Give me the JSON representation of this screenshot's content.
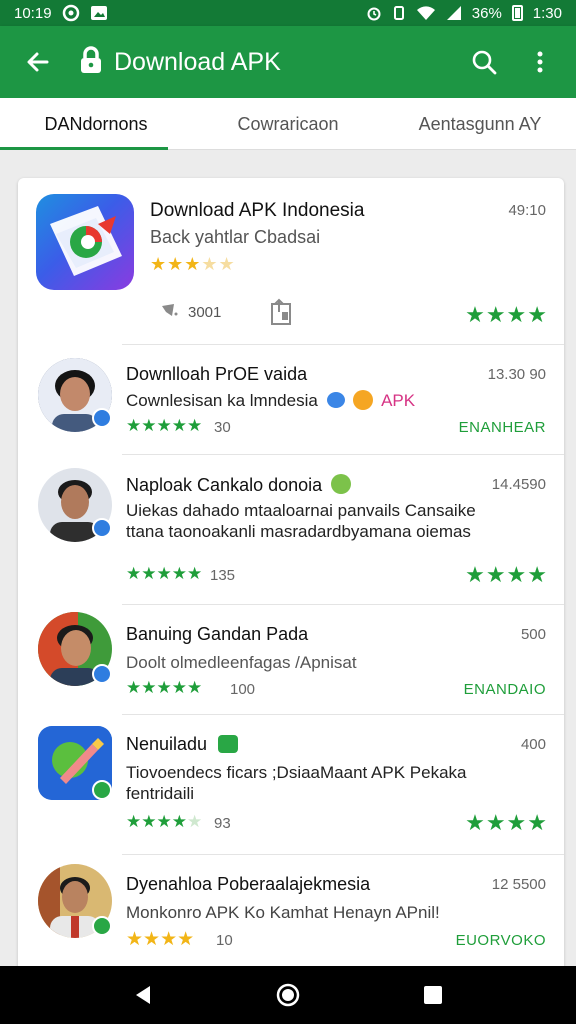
{
  "status_bar": {
    "time": "10:19",
    "battery": "36%",
    "clock_right": "1:30"
  },
  "app_bar": {
    "title": "Download APK"
  },
  "tabs": [
    {
      "label": "DANdornons"
    },
    {
      "label": "Cowraricaon"
    },
    {
      "label": "Aentasgunn AY"
    }
  ],
  "featured": {
    "title": "Download APK Indonesia",
    "subtitle": "Back yahtlar Cbadsai",
    "stars": "★★★☆☆",
    "time": "49:10",
    "count": "3001"
  },
  "rows": [
    {
      "title": "Downlloah PrOE vaida",
      "desc": "Cownlesisan ka lmndesia",
      "desc_tail": "APK",
      "time": "13.30 90",
      "count": "30",
      "action": "ENANHEAR"
    },
    {
      "title": "Naploak Cankalo donoia",
      "desc": "Uiekas dahado mtaaloarnai panvails Cansaike ttana taonoakanli masradardbyamana oiemas",
      "time": "14.4590",
      "count": "135"
    },
    {
      "title": "Banuing Gandan Pada",
      "desc": "Doolt olmedleenfagas /Apnisat",
      "time": "500",
      "count": "100",
      "action": "ENANDAIO"
    },
    {
      "title": "Nenuiladu",
      "desc": "Tiovoendecs ficars ;DsiaaMaant APK Pekaka fentridaili",
      "time": "400",
      "count": "93"
    },
    {
      "title": "Dyenahloa Poberaalajekmesia",
      "desc": "Monkonro APK Ko Kamhat Henayn APnil!",
      "time": "12 5500",
      "count": "10",
      "action": "EUORVOKO"
    }
  ],
  "colors": {
    "primary": "#1d9644",
    "status": "#137a36",
    "star_green": "#1f9e3a",
    "star_gold": "#f2b517"
  },
  "icons": [
    "back-arrow-icon",
    "lock-icon",
    "search-icon",
    "more-vert-icon",
    "pin-icon",
    "share-icon",
    "nav-back-icon",
    "nav-home-icon",
    "nav-recent-icon"
  ]
}
